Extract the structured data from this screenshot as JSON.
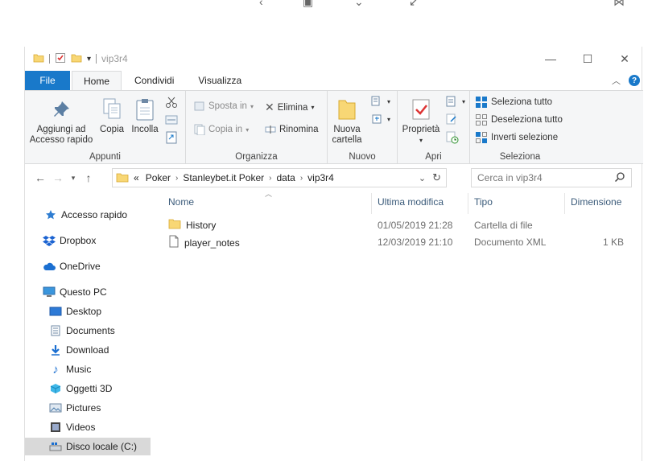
{
  "window": {
    "title": "vip3r4",
    "controls": {
      "minimize": "—",
      "maximize": "☐",
      "close": "✕"
    }
  },
  "ribbon_tabs": [
    {
      "label": "File"
    },
    {
      "label": "Home"
    },
    {
      "label": "Condividi"
    },
    {
      "label": "Visualizza"
    }
  ],
  "ribbon": {
    "appunti": {
      "label": "Appunti",
      "pin": "Aggiungi ad\nAccesso rapido",
      "copy": "Copia",
      "paste": "Incolla"
    },
    "organizza": {
      "label": "Organizza",
      "move": "Sposta in",
      "copyto": "Copia in",
      "delete": "Elimina",
      "rename": "Rinomina"
    },
    "nuovo": {
      "label": "Nuovo",
      "newfolder": "Nuova\ncartella"
    },
    "apri": {
      "label": "Apri",
      "properties": "Proprietà"
    },
    "seleziona": {
      "label": "Seleziona",
      "selectall": "Seleziona tutto",
      "deselectall": "Deseleziona tutto",
      "invert": "Inverti selezione"
    }
  },
  "address": {
    "prefix": "«",
    "crumbs": [
      "Poker",
      "Stanleybet.it Poker",
      "data",
      "vip3r4"
    ]
  },
  "search": {
    "placeholder": "Cerca in vip3r4"
  },
  "nav_pane": {
    "items": [
      {
        "label": "Accesso rapido",
        "icon": "star-icon"
      },
      {
        "label": "Dropbox",
        "icon": "dropbox-icon"
      },
      {
        "label": "OneDrive",
        "icon": "cloud-icon"
      },
      {
        "label": "Questo PC",
        "icon": "computer-icon"
      },
      {
        "label": "Desktop",
        "icon": "desktop-icon"
      },
      {
        "label": "Documents",
        "icon": "documents-icon"
      },
      {
        "label": "Download",
        "icon": "download-icon"
      },
      {
        "label": "Music",
        "icon": "music-icon"
      },
      {
        "label": "Oggetti 3D",
        "icon": "objects-3d-icon"
      },
      {
        "label": "Pictures",
        "icon": "pictures-icon"
      },
      {
        "label": "Videos",
        "icon": "videos-icon"
      },
      {
        "label": "Disco locale (C:)",
        "icon": "drive-icon"
      }
    ],
    "selected": "Disco locale (C:)"
  },
  "columns": {
    "name": "Nome",
    "modified": "Ultima modifica",
    "type": "Tipo",
    "size": "Dimensione"
  },
  "files": [
    {
      "name": "History",
      "modified": "01/05/2019 21:28",
      "type": "Cartella di file",
      "size": "",
      "icon": "folder-icon"
    },
    {
      "name": "player_notes",
      "modified": "12/03/2019 21:10",
      "type": "Documento XML",
      "size": "1 KB",
      "icon": "file-icon"
    }
  ],
  "colors": {
    "accent": "#1979ca",
    "folder": "#f8d775",
    "ribbon_bg": "#f5f6f7",
    "selected_bg": "#d9d9d9"
  }
}
